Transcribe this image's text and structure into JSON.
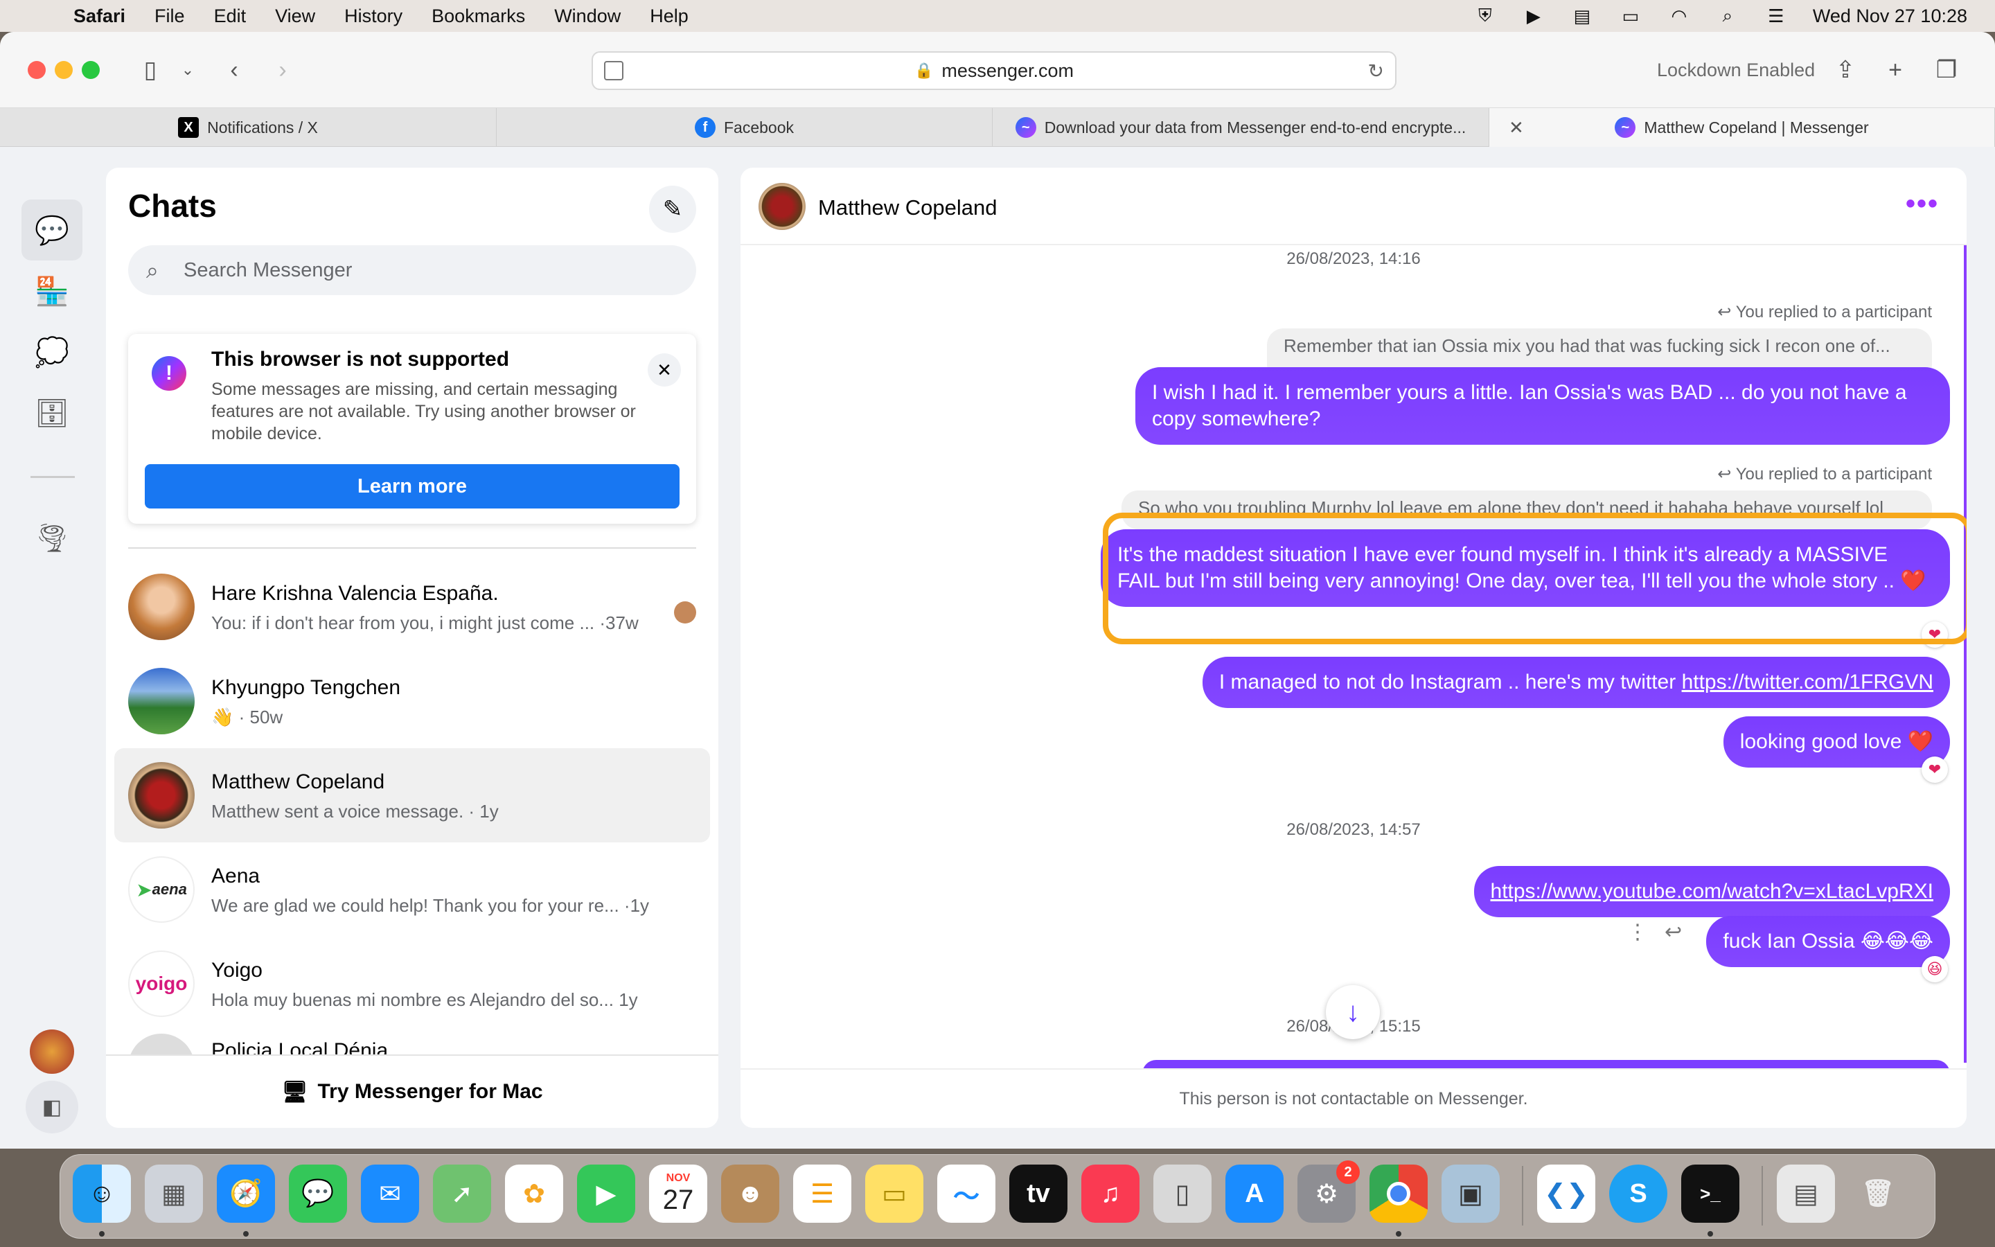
{
  "menubar": {
    "app": "Safari",
    "items": [
      "File",
      "Edit",
      "View",
      "History",
      "Bookmarks",
      "Window",
      "Help"
    ],
    "datetime": "Wed Nov 27  10:28"
  },
  "toolbar": {
    "url": "messenger.com",
    "lockdown": "Lockdown Enabled"
  },
  "tabs": [
    {
      "label": "Notifications / X",
      "icon": "x-logo-icon"
    },
    {
      "label": "Facebook",
      "icon": "facebook-icon"
    },
    {
      "label": "Download your data from Messenger end-to-end encrypte...",
      "icon": "messenger-icon"
    },
    {
      "label": "Matthew Copeland | Messenger",
      "icon": "messenger-icon"
    }
  ],
  "chats": {
    "title": "Chats",
    "search_placeholder": "Search Messenger",
    "notice": {
      "title": "This browser is not supported",
      "text": "Some messages are missing, and certain messaging features are not available. Try using another browser or mobile device.",
      "button": "Learn more"
    },
    "items": [
      {
        "name": "Hare Krishna Valencia España.",
        "preview": "You: if i don't hear from you, i might just come ... ·37w"
      },
      {
        "name": "Khyungpo Tengchen",
        "preview": "👋 · 50w"
      },
      {
        "name": "Matthew Copeland",
        "preview": "Matthew sent a voice message. · 1y"
      },
      {
        "name": "Aena",
        "preview": "We are glad we could help! Thank you for your re... ·1y",
        "logo": "aena"
      },
      {
        "name": "Yoigo",
        "preview": "Hola muy buenas mi nombre es Alejandro del so...   1y",
        "logo": "yoigo"
      },
      {
        "name": "Policia Local Dénia",
        "preview": ""
      }
    ],
    "footer": "Try Messenger for Mac"
  },
  "conversation": {
    "name": "Matthew Copeland",
    "timestamps": [
      "26/08/2023, 14:16",
      "26/08/2023, 14:57",
      "26/08/2023, 15:15"
    ],
    "reply_meta": "You replied to a participant",
    "quoted_1": "Remember that ian Ossia mix you had that was fucking sick I recon one of...",
    "quoted_2": "So who you troubling Murphy lol leave em alone they don't need it hahaha behave yourself lol",
    "messages": [
      "I wish I had it. I remember yours a little. Ian Ossia's was BAD ... do you not have a copy somewhere?",
      "It's the maddest situation I have ever found myself in. I think it's already a MASSIVE FAIL but I'm still being very annoying! One day, over tea, I'll tell you the whole story .. ❤️",
      "looking good love ❤️",
      "fuck Ian Ossia 😂😂😂"
    ],
    "twitter_msg_prefix": "I managed to not do Instagram .. here's my twitter ",
    "twitter_link": "https://twitter.com/1FRGVN",
    "youtube_link": "https://www.youtube.com/watch?v=xLtacLvpRXI",
    "not_contactable": "This person is not contactable on Messenger."
  },
  "dock": {
    "calendar_month": "NOV",
    "calendar_day": "27",
    "settings_badge": "2"
  }
}
